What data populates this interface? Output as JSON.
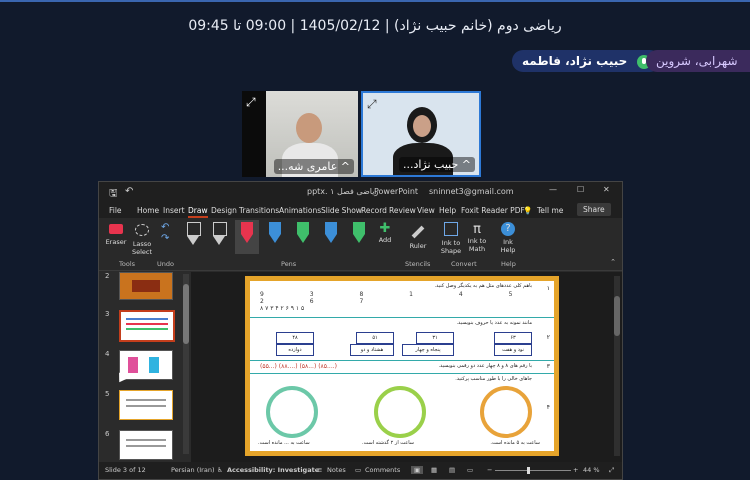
{
  "meeting": {
    "title": "ریاضی دوم (خانم حبیب نژاد) | 1405/02/12 | 09:00 تا 09:45",
    "active_speaker": "حبیب نژاد، فاطمه",
    "other_participant": "شهرابی، شروین"
  },
  "videos": [
    {
      "name": "^ عامری شه...",
      "icon": "expand-icon"
    },
    {
      "name": "^ حبیب نژاد...",
      "icon": "expand-icon"
    }
  ],
  "ppt": {
    "file_name": "ریاضی فصل ۱ .pptx",
    "app_name": "PowerPoint",
    "account": "sninnet3@gmail.com",
    "tell_me": "Tell me",
    "share": "Share",
    "menu": [
      "File",
      "Home",
      "Insert",
      "Draw",
      "Design",
      "Transitions",
      "Animations",
      "Slide Show",
      "Record",
      "Review",
      "View",
      "Help",
      "Foxit Reader PDF"
    ],
    "active_menu": "Draw",
    "ribbon": {
      "eraser": "Eraser",
      "lasso": "Lasso Select",
      "tools_group": "Tools",
      "undo_group": "Undo",
      "add": "Add",
      "pens_group": "Pens",
      "ruler": "Ruler",
      "stencils_group": "Stencils",
      "ink_to_shape": "Ink to Shape",
      "ink_to_math": "Ink to Math",
      "convert_group": "Convert",
      "ink_help": "Ink Help",
      "help_group": "Help",
      "pen_colors": [
        "#ffffff",
        "#ffffff",
        "#e8344e",
        "#3c8fd8",
        "#3fbf6b",
        "#3c8fd8",
        "#3fbf6b"
      ]
    },
    "thumbnails": [
      "2",
      "3",
      "4",
      "5",
      "6"
    ],
    "selected_slide": "3",
    "slide": {
      "q1": "باهم کلی عددهای مثل هم به یکدیگر وصل کنید.",
      "q1_digits_top": "9 3 8 1 4 5 2 6 7",
      "q1_digits_bottom": "۸ ۷ ۳ ۴ ۲ ۶ ۹ ۱ ۵",
      "q2": "مانند نمونه به عدد یا حروف بنویسید.",
      "q2_cells_top": [
        "۶۳",
        "۳۱",
        "۵۱",
        "۴۸"
      ],
      "q2_cells_bottom": [
        "نود و هفت",
        "پنجاه و چهار",
        "هشتاد و دو",
        "دوازده"
      ],
      "q3": "با رقم های ۸ و ۸ چهار عدد دو رقمی بنویسید.",
      "q3_answers": "(....۸۵)  (...۵۸)  (....۸۸)  (...۵۵)",
      "q4": "جاهای خالی را با طور مناسب پرکنید.",
      "q4_captions": [
        "ساعت به ۵ مانده است.",
        "ساعت از ۲ گذشته است.",
        "ساعت به ... مانده است."
      ],
      "row_numbers": [
        "۱",
        "۲",
        "۳",
        "۴"
      ]
    },
    "status": {
      "slide": "Slide 3 of 12",
      "language": "Persian (Iran)",
      "accessibility": "Accessibility: Investigate",
      "notes": "Notes",
      "comments": "Comments",
      "zoom": "44 %"
    }
  }
}
